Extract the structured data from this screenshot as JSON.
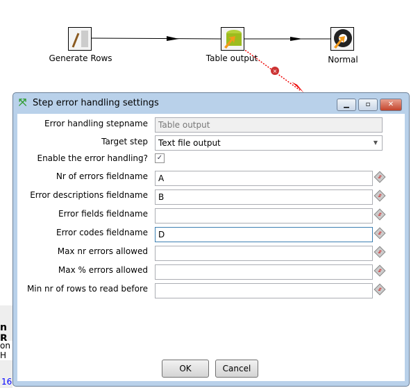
{
  "canvas": {
    "steps": [
      {
        "label": "Generate Rows",
        "icon": "generate-rows-icon"
      },
      {
        "label": "Table output",
        "icon": "table-output-icon"
      },
      {
        "label": "Normal",
        "icon": "normal-step-icon"
      }
    ]
  },
  "background_panel": {
    "texts": [
      "n R",
      "on H",
      "16:"
    ]
  },
  "dialog": {
    "title": "Step error handling settings",
    "fields": {
      "stepname": {
        "label": "Error handling stepname",
        "value": "Table output"
      },
      "target": {
        "label": "Target step",
        "value": "Text file output"
      },
      "enable": {
        "label": "Enable the error handling?",
        "checked": true
      },
      "nr_errors": {
        "label": "Nr of errors fieldname",
        "value": "A"
      },
      "descriptions": {
        "label": "Error descriptions fieldname",
        "value": "B"
      },
      "fields": {
        "label": "Error fields fieldname",
        "value": ""
      },
      "codes": {
        "label": "Error codes fieldname",
        "value": "D"
      },
      "max_nr": {
        "label": "Max nr errors allowed",
        "value": ""
      },
      "max_pct": {
        "label": "Max % errors allowed",
        "value": ""
      },
      "min_rows": {
        "label": "Min nr of rows to read before",
        "value": ""
      }
    },
    "ok": "OK",
    "cancel": "Cancel"
  }
}
